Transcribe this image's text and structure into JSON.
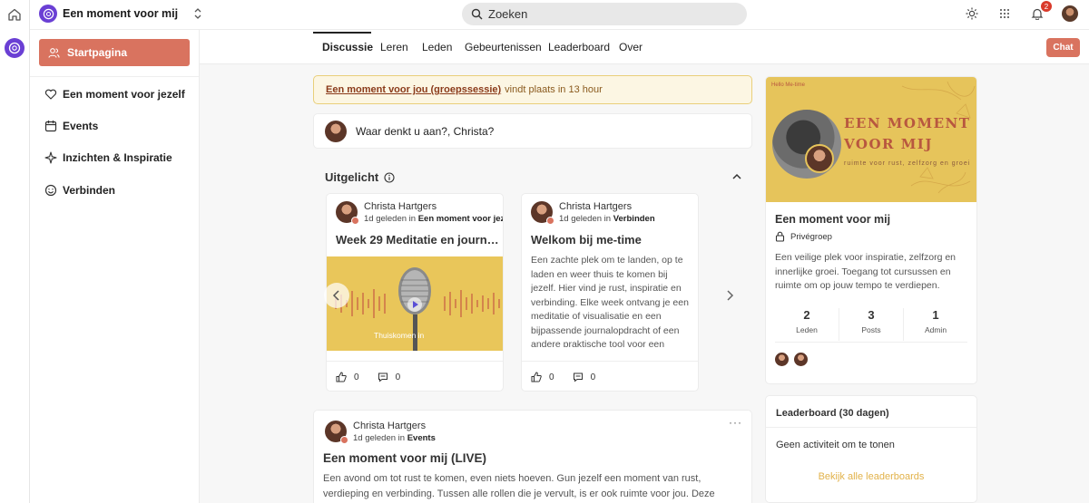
{
  "topbar": {
    "group_name": "Een moment voor mij",
    "search_placeholder": "Zoeken",
    "notification_count": "2"
  },
  "sidebar": {
    "active": "Startpagina",
    "items": [
      {
        "label": "Een moment voor jezelf",
        "icon": "heart-icon"
      },
      {
        "label": "Events",
        "icon": "calendar-icon"
      },
      {
        "label": "Inzichten & Inspiratie",
        "icon": "sparkle-icon"
      },
      {
        "label": "Verbinden",
        "icon": "smile-icon"
      }
    ]
  },
  "tabs": [
    "Discussie",
    "Leren",
    "Leden",
    "Gebeurtenissen",
    "Leaderboard",
    "Over"
  ],
  "chat_label": "Chat",
  "banner": {
    "link": "Een moment voor jou (groepssessie)",
    "text": "vindt plaats in 13 hour"
  },
  "composer": {
    "prompt": "Waar denkt u aan?, Christa?"
  },
  "featured": {
    "title": "Uitgelicht",
    "cards": [
      {
        "author": "Christa Hartgers",
        "time": "1d geleden in",
        "space": "Een moment voor jezelf",
        "title": "Week 29 Meditatie en journal...",
        "thumb_text": "Thuiskomen in",
        "likes": "0",
        "comments": "0"
      },
      {
        "author": "Christa Hartgers",
        "time": "1d geleden in",
        "space": "Verbinden",
        "title": "Welkom bij me-time",
        "body": "Een zachte plek om te landen, op te laden en weer thuis te komen bij jezelf. Hier vind je rust, inspiratie en verbinding. Elke week ontvang je een meditatie of visualisatie en een bijpassende journalopdracht of een andere praktische tool voor een",
        "likes": "0",
        "comments": "0"
      }
    ]
  },
  "post": {
    "author": "Christa Hartgers",
    "time": "1d geleden in",
    "space": "Events",
    "title": "Een moment voor mij (LIVE)",
    "body": "Een avond om tot rust te komen, even niets hoeven. Gun jezelf een moment van rust, verdieping en verbinding. Tussen alle rollen die je vervult, is er ook ruimte voor jou. Deze avond is een zachte…"
  },
  "group_card": {
    "cover_heading_line1": "EEN MOMENT",
    "cover_heading_line2": "VOOR MIJ",
    "cover_tagline": "ruimte voor rust, zelfzorg en groei",
    "cover_brand": "Hello Me-time",
    "title": "Een moment voor mij",
    "privacy": "Privégroep",
    "description": "Een veilige plek voor inspiratie, zelfzorg en innerlijke groei. Toegang tot cursussen en ruimte om op jouw tempo te verdiepen.",
    "stats": [
      {
        "value": "2",
        "label": "Leden"
      },
      {
        "value": "3",
        "label": "Posts"
      },
      {
        "value": "1",
        "label": "Admin"
      }
    ]
  },
  "leaderboard": {
    "title": "Leaderboard (30 dagen)",
    "empty": "Geen activiteit om te tonen",
    "link": "Bekijk alle leaderboards"
  },
  "colors": {
    "accent": "#d9735f",
    "brand": "#6a3fd4",
    "banner_bg": "#fcf6e3",
    "link_gold": "#e2b24a"
  }
}
